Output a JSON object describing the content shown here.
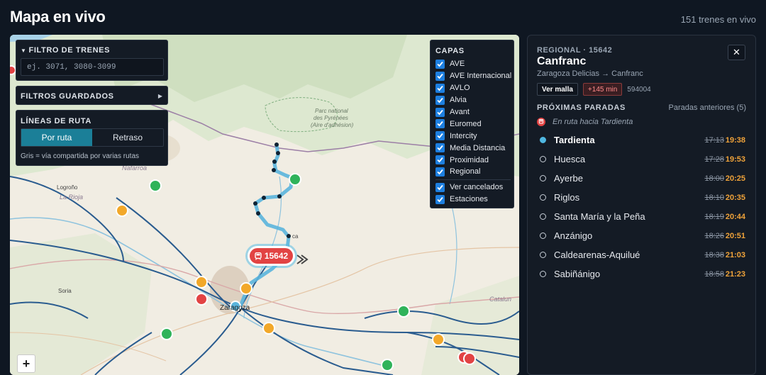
{
  "header": {
    "title": "Mapa en vivo",
    "count": "151 trenes en vivo"
  },
  "filter": {
    "title": "FILTRO DE TRENES",
    "placeholder": "ej. 3071, 3080-3099"
  },
  "saved_filters": {
    "title": "FILTROS GUARDADOS"
  },
  "route_lines": {
    "title": "LÍNEAS DE RUTA",
    "options": [
      "Por ruta",
      "Retraso"
    ],
    "selected": "Por ruta",
    "note": "Gris = vía compartida por varias rutas"
  },
  "layers": {
    "title": "CAPAS",
    "items": [
      {
        "label": "AVE",
        "checked": true
      },
      {
        "label": "AVE Internacional",
        "checked": true
      },
      {
        "label": "AVLO",
        "checked": true
      },
      {
        "label": "Alvia",
        "checked": true
      },
      {
        "label": "Avant",
        "checked": true
      },
      {
        "label": "Euromed",
        "checked": true
      },
      {
        "label": "Intercity",
        "checked": true
      },
      {
        "label": "Media Distancia",
        "checked": true
      },
      {
        "label": "Proximidad",
        "checked": true
      },
      {
        "label": "Regional",
        "checked": true
      }
    ],
    "extra": [
      {
        "label": "Ver cancelados",
        "checked": true
      },
      {
        "label": "Estaciones",
        "checked": true
      }
    ]
  },
  "map": {
    "labels": {
      "park": [
        "Parc national",
        "des Pyrénées",
        "(Aire d'adhésion)"
      ],
      "navarra": "Nafarroa",
      "logrono": "Logroño",
      "rioja": "La Rioja",
      "soria": "Soria",
      "zaragoza": "Zaragoza",
      "catalunya": "Catalun",
      "huesca_partial": "ca"
    },
    "train_callout": "15642",
    "zoom_in": "+"
  },
  "details": {
    "kicker": "REGIONAL · 15642",
    "destination": "Canfranc",
    "route": "Zaragoza Delicias → Canfranc",
    "close": "✕",
    "malla": "Ver malla",
    "delay": "+145 min",
    "composition": "594004",
    "next_stops_label": "PRÓXIMAS PARADAS",
    "previous_link": "Paradas anteriores (5)",
    "en_route": "En ruta hacia Tardienta",
    "stops": [
      {
        "name": "Tardienta",
        "scheduled": "17:13",
        "estimated": "19:38",
        "current": true
      },
      {
        "name": "Huesca",
        "scheduled": "17:28",
        "estimated": "19:53",
        "current": false
      },
      {
        "name": "Ayerbe",
        "scheduled": "18:00",
        "estimated": "20:25",
        "current": false
      },
      {
        "name": "Riglos",
        "scheduled": "18:10",
        "estimated": "20:35",
        "current": false
      },
      {
        "name": "Santa María y la Peña",
        "scheduled": "18:19",
        "estimated": "20:44",
        "current": false
      },
      {
        "name": "Anzánigo",
        "scheduled": "18:26",
        "estimated": "20:51",
        "current": false
      },
      {
        "name": "Caldearenas-Aquilué",
        "scheduled": "18:38",
        "estimated": "21:03",
        "current": false
      },
      {
        "name": "Sabiñánigo",
        "scheduled": "18:58",
        "estimated": "21:23",
        "current": false
      }
    ]
  },
  "colors": {
    "accent": "#1b7f98",
    "route": "#5ab4dc",
    "delay": "#f0a33a",
    "danger": "#e24343",
    "checkbox": "#1d7fe0"
  }
}
